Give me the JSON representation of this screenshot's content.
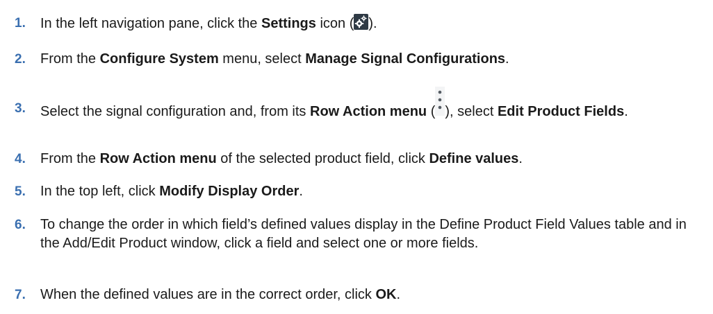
{
  "steps": [
    {
      "number": "1.",
      "parts": {
        "a": "In the left navigation pane, click the ",
        "b": "Settings",
        "c": " icon (",
        "d": ")."
      }
    },
    {
      "number": "2.",
      "parts": {
        "a": "From the ",
        "b": "Configure System",
        "c": " menu, select ",
        "d": "Manage Signal Configurations",
        "e": "."
      }
    },
    {
      "number": "3.",
      "parts": {
        "a": "Select the signal configuration and, from its ",
        "b": "Row Action menu",
        "c": " (",
        "d": "), select ",
        "e": "Edit Product Fields",
        "f": "."
      }
    },
    {
      "number": "4.",
      "parts": {
        "a": "From the ",
        "b": "Row Action menu",
        "c": " of the selected product field, click ",
        "d": "Define values",
        "e": "."
      }
    },
    {
      "number": "5.",
      "parts": {
        "a": "In the top left, click ",
        "b": "Modify Display Order",
        "c": "."
      }
    },
    {
      "number": "6.",
      "parts": {
        "a": "To change the order in which field’s defined values display in the Define Product Field Values table and in the Add/Edit Product window, click a field and select one or more fields."
      }
    },
    {
      "number": "7.",
      "parts": {
        "a": "When the defined values are in the correct order, click ",
        "b": "OK",
        "c": "."
      }
    }
  ],
  "icons": {
    "settings": "gear-icon",
    "row_action": "vertical-ellipsis-icon"
  },
  "colors": {
    "step_number": "#3a6fb0",
    "text": "#1a1a1a",
    "settings_icon_bg": "#2f3a45"
  }
}
